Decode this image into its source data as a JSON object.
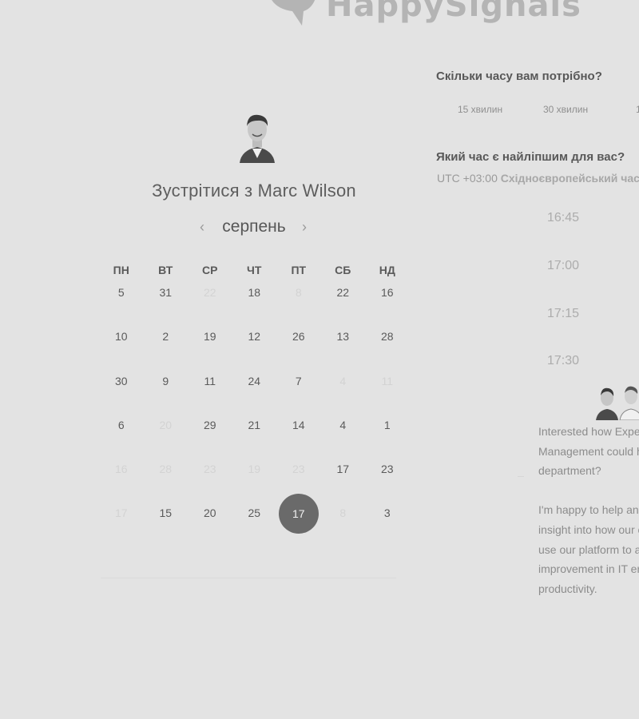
{
  "brand": {
    "name": "HappySignals"
  },
  "host": {
    "title_prefix": "Зустрітися з",
    "name": "Marc Wilson"
  },
  "calendar": {
    "month": "серпень",
    "prev_icon": "chevron-left-icon",
    "next_icon": "chevron-right-icon",
    "weekdays": [
      "ПН",
      "ВТ",
      "СР",
      "ЧТ",
      "ПТ",
      "СБ",
      "НД"
    ],
    "weeks": [
      [
        {
          "d": "5"
        },
        {
          "d": "31"
        },
        {
          "d": "22",
          "faded": true
        },
        {
          "d": "18"
        },
        {
          "d": "8",
          "faded": true
        },
        {
          "d": "22"
        },
        {
          "d": "16"
        }
      ],
      [
        {
          "d": "10"
        },
        {
          "d": "2"
        },
        {
          "d": "19"
        },
        {
          "d": "12"
        },
        {
          "d": "26"
        },
        {
          "d": "13"
        },
        {
          "d": "28"
        }
      ],
      [
        {
          "d": "30"
        },
        {
          "d": "9"
        },
        {
          "d": "11"
        },
        {
          "d": "24"
        },
        {
          "d": "7"
        },
        {
          "d": "4",
          "faded": true
        },
        {
          "d": "11",
          "faded": true
        }
      ],
      [
        {
          "d": "6"
        },
        {
          "d": "20",
          "faded": true
        },
        {
          "d": "29"
        },
        {
          "d": "21"
        },
        {
          "d": "14"
        },
        {
          "d": "4"
        },
        {
          "d": "1"
        }
      ],
      [
        {
          "d": "16",
          "faded": true
        },
        {
          "d": "28",
          "faded": true
        },
        {
          "d": "23",
          "faded": true
        },
        {
          "d": "19",
          "faded": true
        },
        {
          "d": "23",
          "faded": true
        },
        {
          "d": "17"
        },
        {
          "d": "23"
        }
      ],
      [
        {
          "d": "17",
          "faded": true
        },
        {
          "d": "15"
        },
        {
          "d": "20"
        },
        {
          "d": "25"
        },
        {
          "d": "17",
          "selected": true
        },
        {
          "d": "8",
          "faded": true
        },
        {
          "d": "3"
        }
      ]
    ]
  },
  "duration": {
    "question": "Скільки часу вам потрібно?",
    "options": [
      "15 хвилин",
      "30 хвилин",
      "1"
    ]
  },
  "time": {
    "question": "Який час є найліпшим для вас?",
    "timezone_offset": "UTC +03:00",
    "timezone_name": "Східноєвропейський час",
    "slots": [
      "16:45",
      "17:00",
      "17:15",
      "17:30"
    ]
  },
  "info": {
    "paragraph1": [
      "Interested how Expe",
      "Management could h",
      "department?"
    ],
    "paragraph2": [
      "I'm happy to help and",
      "insight into how our c",
      "use our platform to a",
      "improvement in IT er",
      "productivity."
    ]
  },
  "colors": {
    "background": "#e3e3e3",
    "selected_day": "#6a6a6a",
    "logo": "#b4b4b4"
  }
}
